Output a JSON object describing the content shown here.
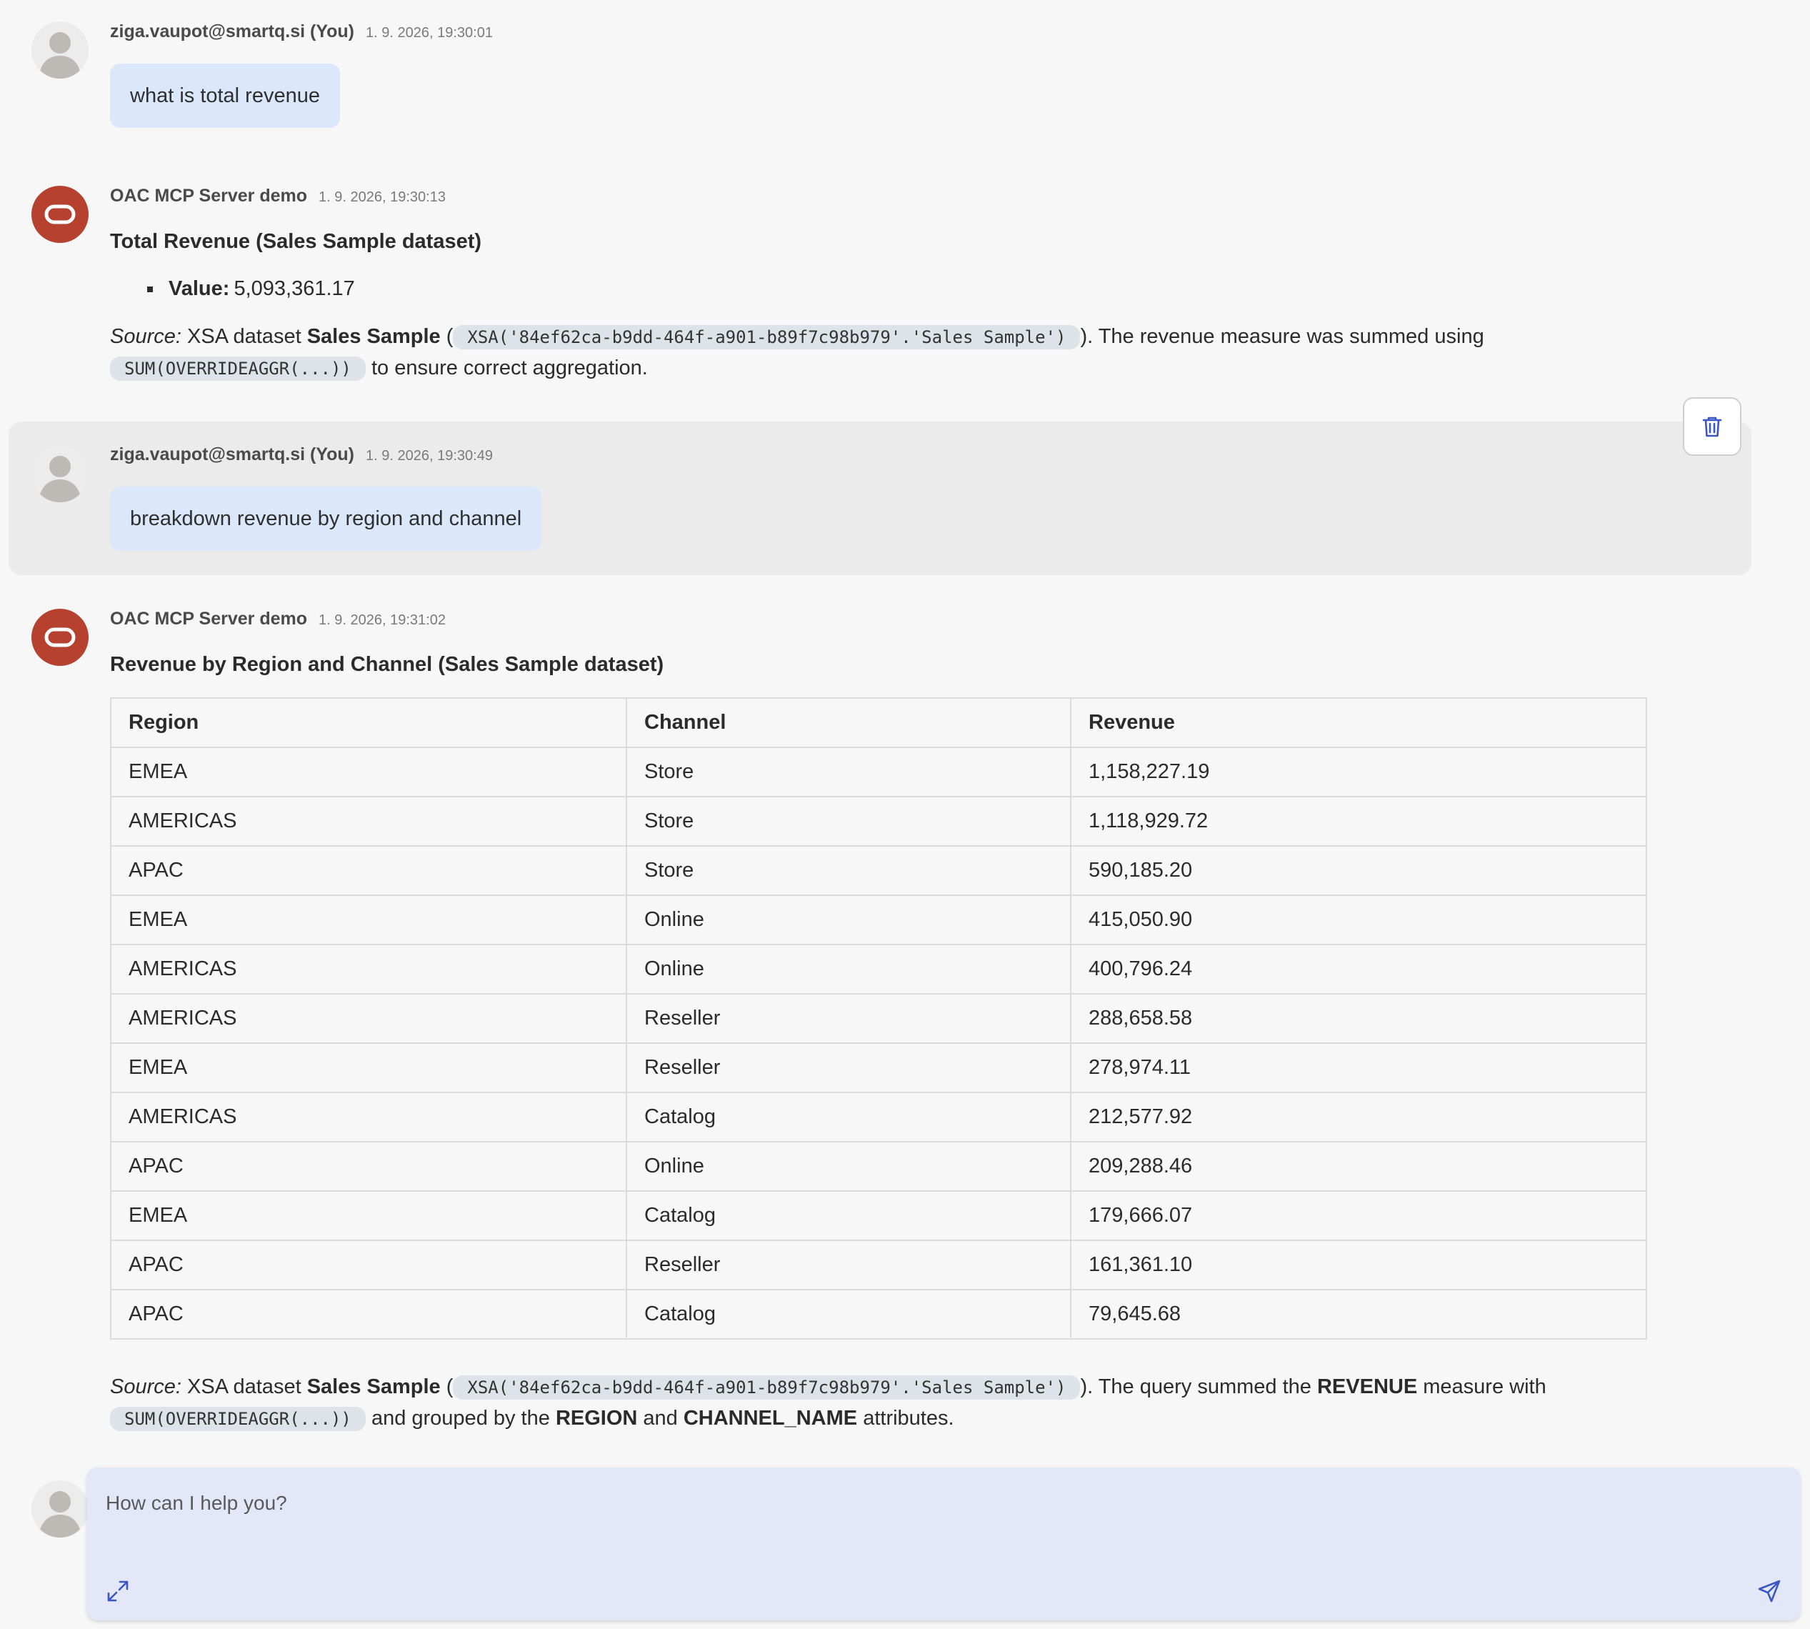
{
  "messages": [
    {
      "author": "ziga.vaupot@smartq.si (You)",
      "timestamp": "1. 9. 2026, 19:30:01",
      "text": "what is total revenue"
    },
    {
      "author": "OAC MCP Server demo",
      "timestamp": "1. 9. 2026, 19:30:13",
      "title": "Total Revenue (Sales Sample dataset)",
      "value_label": "Value:",
      "value": "5,093,361.17",
      "source_label": "Source:",
      "source_text1": " XSA dataset ",
      "source_dataset": "Sales Sample",
      "source_open": " (",
      "source_code": "XSA('84ef62ca-b9dd-464f-a901-b89f7c98b979'.'Sales Sample')",
      "source_text2": "). The revenue measure was summed using",
      "sum_code": "SUM(OVERRIDEAGGR(...))",
      "source_text3": " to ensure correct aggregation."
    },
    {
      "author": "ziga.vaupot@smartq.si (You)",
      "timestamp": "1. 9. 2026, 19:30:49",
      "text": "breakdown revenue by region and channel"
    },
    {
      "author": "OAC MCP Server demo",
      "timestamp": "1. 9. 2026, 19:31:02",
      "title": "Revenue by Region and Channel (Sales Sample dataset)",
      "table": {
        "headers": [
          "Region",
          "Channel",
          "Revenue"
        ],
        "rows": [
          [
            "EMEA",
            "Store",
            "1,158,227.19"
          ],
          [
            "AMERICAS",
            "Store",
            "1,118,929.72"
          ],
          [
            "APAC",
            "Store",
            "590,185.20"
          ],
          [
            "EMEA",
            "Online",
            "415,050.90"
          ],
          [
            "AMERICAS",
            "Online",
            "400,796.24"
          ],
          [
            "AMERICAS",
            "Reseller",
            "288,658.58"
          ],
          [
            "EMEA",
            "Reseller",
            "278,974.11"
          ],
          [
            "AMERICAS",
            "Catalog",
            "212,577.92"
          ],
          [
            "APAC",
            "Online",
            "209,288.46"
          ],
          [
            "EMEA",
            "Catalog",
            "179,666.07"
          ],
          [
            "APAC",
            "Reseller",
            "161,361.10"
          ],
          [
            "APAC",
            "Catalog",
            "79,645.68"
          ]
        ]
      },
      "source_label": "Source:",
      "source_text1": " XSA dataset ",
      "source_dataset": "Sales Sample",
      "source_open": " (",
      "source_code": "XSA('84ef62ca-b9dd-464f-a901-b89f7c98b979'.'Sales Sample')",
      "source_text2": "). The query summed the ",
      "revenue_bold": "REVENUE",
      "source_text3": " measure with",
      "sum_code": "SUM(OVERRIDEAGGR(...))",
      "source_text4": " and grouped by the ",
      "region_bold": "REGION",
      "and_text": " and ",
      "channel_bold": "CHANNEL_NAME",
      "source_text5": " attributes."
    }
  ],
  "composer": {
    "placeholder": "How can I help you?",
    "expand_icon": "expand-icon",
    "send_icon": "send-icon"
  },
  "icons": {
    "delete": "trash-icon",
    "user_avatar": "user-avatar-icon",
    "bot_avatar": "oracle-logo-icon"
  },
  "colors": {
    "user_bubble": "#dbe7fa",
    "bot_avatar": "#b5412e",
    "composer_bg": "#e3e7f7",
    "accent": "#3b57c4"
  }
}
